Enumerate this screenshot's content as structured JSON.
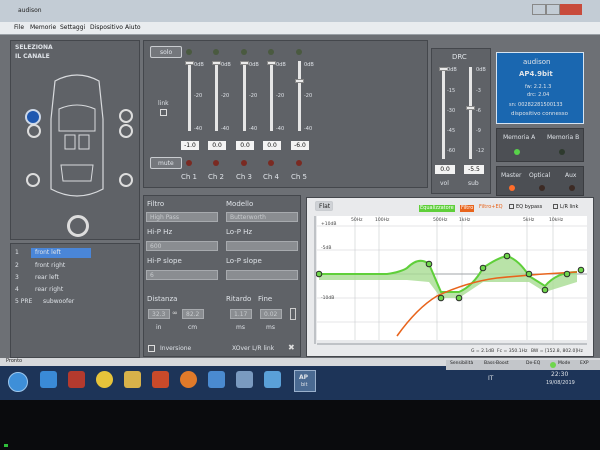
{
  "window": {
    "title": "audison"
  },
  "menu": [
    "File",
    "Memorie",
    "Settaggi",
    "Dispositivo",
    "Aiuto"
  ],
  "channel_select": {
    "title_line1": "SELEZIONA",
    "title_line2": "IL CANALE"
  },
  "channels": [
    {
      "num": "1",
      "name": "front left"
    },
    {
      "num": "2",
      "name": "front right"
    },
    {
      "num": "3",
      "name": "rear left"
    },
    {
      "num": "4",
      "name": "rear right"
    },
    {
      "num": "5 PRE",
      "name": "subwoofer"
    }
  ],
  "levels": {
    "solo_label": "solo",
    "link_label": "link",
    "mute_label": "mute",
    "scale": [
      "0dB",
      "-20",
      "-40"
    ],
    "values": [
      "-1.0",
      "0.0",
      "0.0",
      "0.0",
      "-6.0"
    ],
    "channel_labels": [
      "Ch 1",
      "Ch 2",
      "Ch 3",
      "Ch 4",
      "Ch 5"
    ]
  },
  "drc": {
    "title": "DRC",
    "vol_scale": [
      "0dB",
      "-15",
      "-30",
      "-45",
      "-60"
    ],
    "sub_scale": [
      "0dB",
      "-3",
      "-6",
      "-9",
      "-12"
    ],
    "vol_value": "0.0",
    "sub_value": "-5.5",
    "vol_label": "vol",
    "sub_label": "sub"
  },
  "device": {
    "brand": "audison",
    "model": "AP4.9bit",
    "fw": "fw: 2.2.1.3",
    "drc": "drc: 2.04",
    "sn": "sn: 00282281500133",
    "status": "dispositivo connesso"
  },
  "memory": {
    "a": "Memoria A",
    "b": "Memoria B"
  },
  "sources": [
    "Master",
    "Optical",
    "Aux"
  ],
  "filter": {
    "filtro_label": "Filtro",
    "filtro_value": "High Pass",
    "modello_label": "Modello",
    "modello_value": "Butterworth",
    "hip_hz_label": "Hi-P Hz",
    "hip_hz_value": "600",
    "lop_hz_label": "Lo-P Hz",
    "lop_hz_value": "",
    "hip_slope_label": "Hi-P slope",
    "hip_slope_value": "6",
    "lop_slope_label": "Lo-P slope",
    "lop_slope_value": "",
    "distanza_label": "Distanza",
    "dist_in": "32.3",
    "dist_cm": "82.2",
    "in_unit": "in",
    "cm_unit": "cm",
    "ritardo_label": "Ritardo",
    "ritardo_value": "1.17",
    "ms_unit": "ms",
    "fine_label": "Fine",
    "fine_value": "0.02",
    "fine_unit": "ms",
    "inversione_label": "Inversione",
    "xover_label": "XOver L/R link"
  },
  "eq": {
    "flat_button": "Flat",
    "tag_equalizzatore": "Equalizzatore",
    "tag_filtro": "Filtro",
    "tag_filtro_eq": "Filtro+EQ",
    "eq_bypass": "EQ bypass",
    "lr_link": "L/R link",
    "y_labels": [
      "+10dB",
      "-5dB",
      "-10dB"
    ],
    "x_labels": [
      "50Hz",
      "100Hz",
      "500Hz",
      "1kHz",
      "5kHz",
      "10kHz"
    ],
    "readout_g": "G = 2.1dB",
    "readout_fc": "Fc = 350.1Hz",
    "readout_bw": "BW = [152.8, 802.0]Hz"
  },
  "statusbar": {
    "left": "Pronto",
    "sensibilita": "Sensibilità",
    "bass_boost": "Bass-Boost",
    "de_eq": "De-EQ",
    "mode": "Mode",
    "exp": "EXP"
  },
  "taskbar": {
    "lang": "IT",
    "time": "22:30",
    "date": "19/08/2019",
    "ap_label": "AP",
    "ap_sub": "bit"
  },
  "colors": {
    "accent_blue": "#1a67b0",
    "eq_green": "#5fcf3a",
    "filter_orange": "#e8641c",
    "selected_channel": "#4a86d8"
  }
}
